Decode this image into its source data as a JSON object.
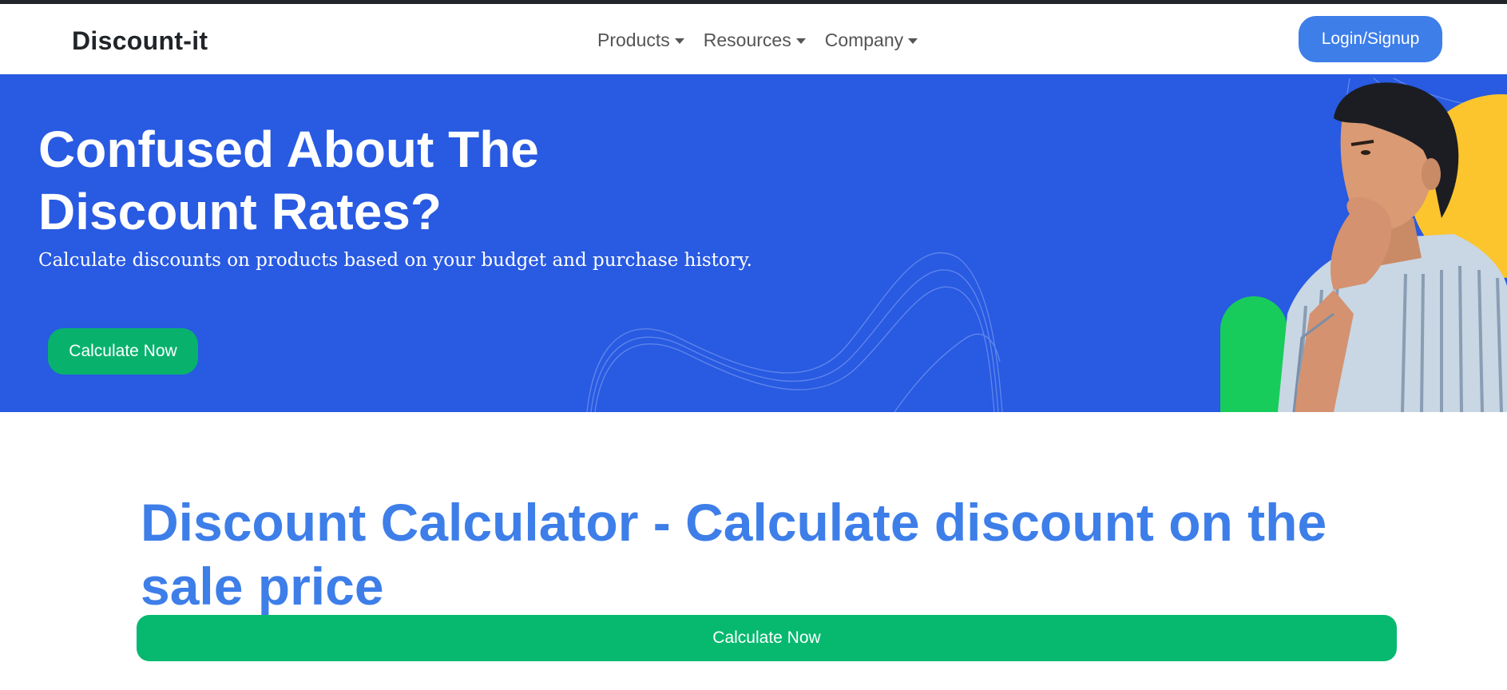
{
  "header": {
    "brand": "Discount-it",
    "nav": [
      {
        "label": "Products"
      },
      {
        "label": "Resources"
      },
      {
        "label": "Company"
      }
    ],
    "login_label": "Login/Signup"
  },
  "hero": {
    "title_line1": "Confused About The",
    "title_line2": "Discount Rates?",
    "subtitle": "Calculate discounts on products based on your budget and purchase history.",
    "cta_label": "Calculate Now"
  },
  "calculator": {
    "title": "Discount Calculator - Calculate discount on the sale price",
    "button_label": "Calculate Now"
  },
  "colors": {
    "hero_bg": "#285ae2",
    "accent_blue": "#3d7ee9",
    "accent_green": "#08b26d",
    "yellow_shape": "#fcc52d",
    "green_shape": "#18cc5b"
  }
}
